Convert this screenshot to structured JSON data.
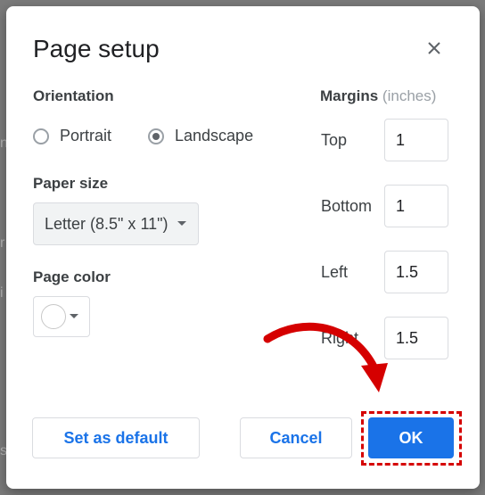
{
  "dialog": {
    "title": "Page setup",
    "close_icon": "close-icon"
  },
  "orientation": {
    "label": "Orientation",
    "options": [
      {
        "label": "Portrait",
        "selected": false
      },
      {
        "label": "Landscape",
        "selected": true
      }
    ]
  },
  "paper_size": {
    "label": "Paper size",
    "value": "Letter (8.5\" x 11\")"
  },
  "page_color": {
    "label": "Page color",
    "value": "#ffffff"
  },
  "margins": {
    "title": "Margins",
    "unit": "(inches)",
    "fields": [
      {
        "label": "Top",
        "value": "1"
      },
      {
        "label": "Bottom",
        "value": "1"
      },
      {
        "label": "Left",
        "value": "1.5"
      },
      {
        "label": "Right",
        "value": "1.5"
      }
    ]
  },
  "buttons": {
    "set_default": "Set as default",
    "cancel": "Cancel",
    "ok": "OK"
  },
  "colors": {
    "accent": "#1a73e8",
    "highlight": "#d50000"
  }
}
